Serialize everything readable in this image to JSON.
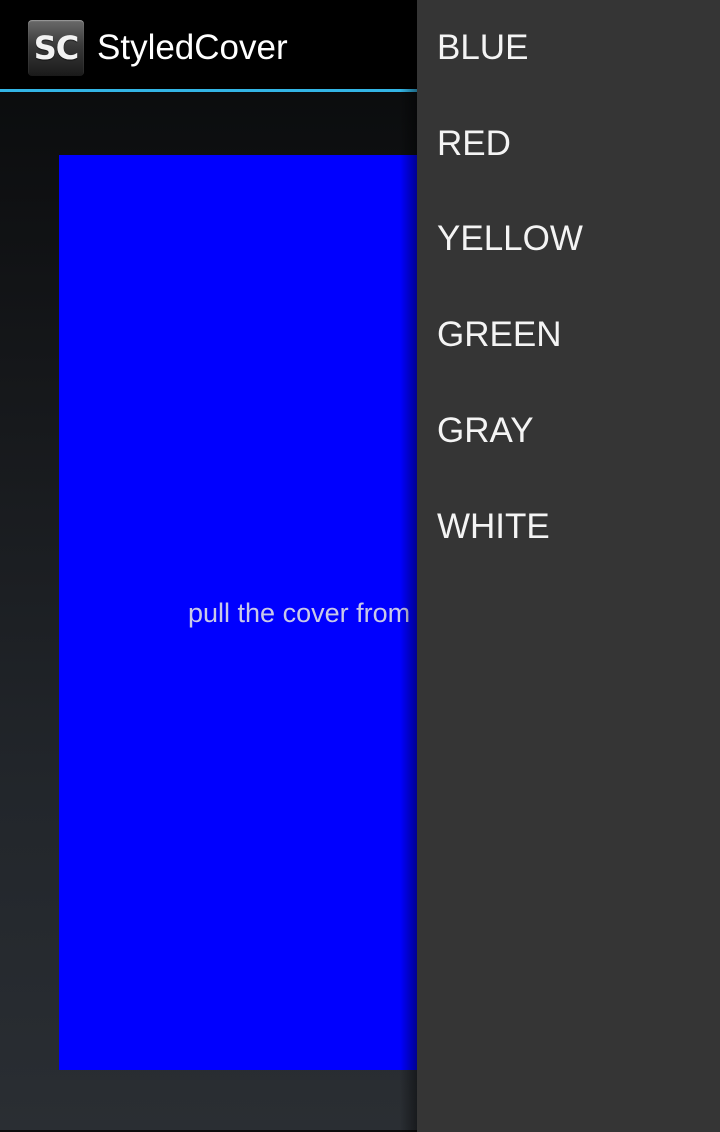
{
  "action_bar": {
    "icon_text": "SC",
    "title": "StyledCover",
    "accent_color": "#33b5e5"
  },
  "content": {
    "cover_color": "#0000ff",
    "hint": "pull the cover from"
  },
  "menu": {
    "items": [
      {
        "label": "BLUE"
      },
      {
        "label": "RED"
      },
      {
        "label": "YELLOW"
      },
      {
        "label": "GREEN"
      },
      {
        "label": "GRAY"
      },
      {
        "label": "WHITE"
      }
    ]
  }
}
